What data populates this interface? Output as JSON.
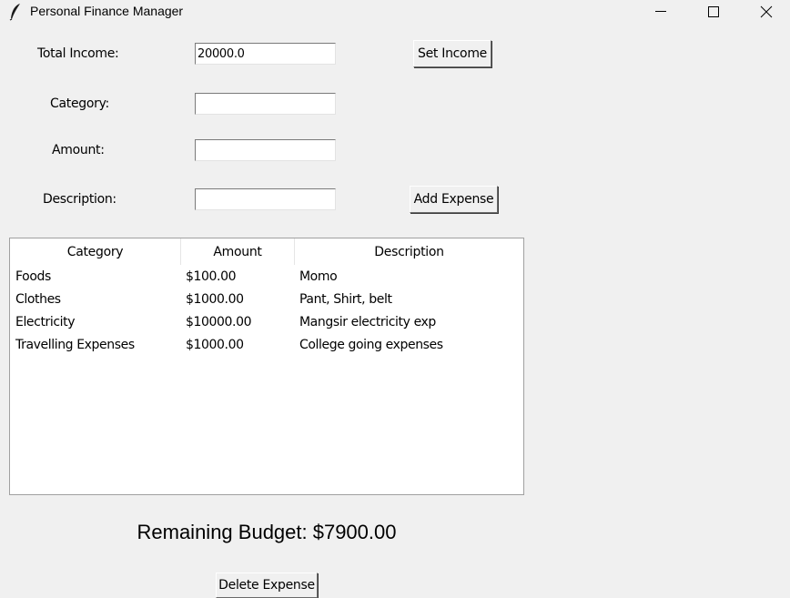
{
  "window": {
    "title": "Personal Finance Manager"
  },
  "form": {
    "income_label": "Total Income:",
    "income_value": "20000.0",
    "set_income_button": "Set Income",
    "category_label": "Category:",
    "category_value": "",
    "amount_label": "Amount:",
    "amount_value": "",
    "description_label": "Description:",
    "description_value": "",
    "add_expense_button": "Add Expense"
  },
  "table": {
    "columns": [
      "Category",
      "Amount",
      "Description"
    ],
    "rows": [
      [
        "Foods",
        "$100.00",
        "Momo"
      ],
      [
        "Clothes",
        "$1000.00",
        "Pant, Shirt, belt"
      ],
      [
        "Electricity",
        "$10000.00",
        "Mangsir electricity exp"
      ],
      [
        "Travelling Expenses",
        "$1000.00",
        "College going expenses"
      ]
    ]
  },
  "summary": {
    "remaining_budget": "Remaining Budget: $7900.00"
  },
  "actions": {
    "delete_expense_button": "Delete Expense"
  },
  "icons": {
    "app": "feather-icon",
    "minimize": "minimize-icon",
    "maximize": "maximize-icon",
    "close": "close-icon"
  }
}
